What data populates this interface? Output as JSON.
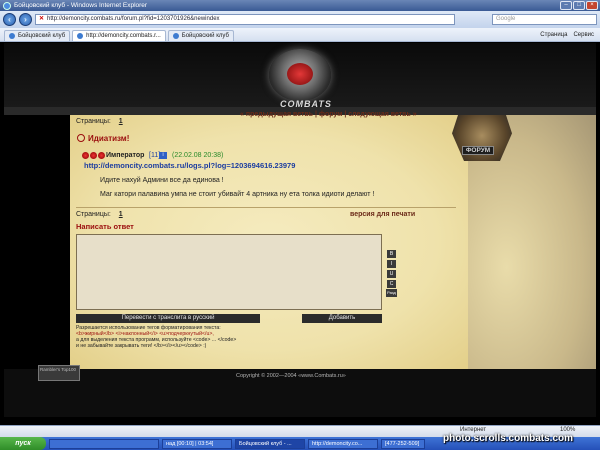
{
  "window": {
    "title": "Бойцовский клуб - Windows Internet Explorer"
  },
  "browser": {
    "address": "http://demoncity.combats.ru/forum.pl?fid=1203701926&newindex",
    "search_placeholder": "Google",
    "tabs": [
      {
        "label": "Бойцовский клуб"
      },
      {
        "label": "http://demoncity.combats.r..."
      },
      {
        "label": "Бойцовский клуб"
      }
    ],
    "tools": {
      "page": "Страница",
      "tools": "Сервис"
    }
  },
  "forum": {
    "logo_text": "COMBATS",
    "badge_label": "ФОРУМ",
    "pages_label": "Страницы:",
    "page_number": "1",
    "nav": {
      "prev": "« предыдущая ветвь",
      "sep1": "|",
      "forum": "форум",
      "sep2": "|",
      "next": "следующая ветвь »"
    },
    "thread_title": "Идиатизм!",
    "post": {
      "author": "Император",
      "level": "[11]",
      "date": "(22.02.08 20:38)",
      "link": "http://demoncity.combats.ru/logs.pl?log=1203694616.23979",
      "line1": "Идите нахуй Админи все да единова !",
      "line2": "Маг катори палавина умпа не стоит убивайт 4 артника ну ета толка идиоти делают !"
    },
    "print_version": "версия для печати",
    "reply_title": "Написать ответ",
    "format_buttons": [
      "B",
      "I",
      "U",
      "C"
    ],
    "size_button": "Разд",
    "translit_button": "Перевести с транслита в русский",
    "submit_button": "Добавить",
    "help": {
      "line1": "Разрешается использование тегов форматирования текста:",
      "line2": "<b>жирный</b> <i>наклонный</i> <u>подчеркнутый</u>,",
      "line3": "а для выделения текста программ, используйте <code> ... </code>",
      "line4": "и не забывайте закрывать теги! </b></i></u></code> :)"
    },
    "counter": "Rambler's Top100",
    "copyright": "Copyright © 2002—2004 «www.Combats.ru»"
  },
  "status": {
    "zone": "Интернет",
    "zoom": "100%"
  },
  "taskbar": {
    "start": "пуск",
    "items": [
      "",
      "над [00:10] | 03:54]",
      "Бойцовский клуб - ...",
      "http://demoncity.co...",
      "[477-252-509]"
    ]
  },
  "watermark": "photo.scrolls.combats.com"
}
